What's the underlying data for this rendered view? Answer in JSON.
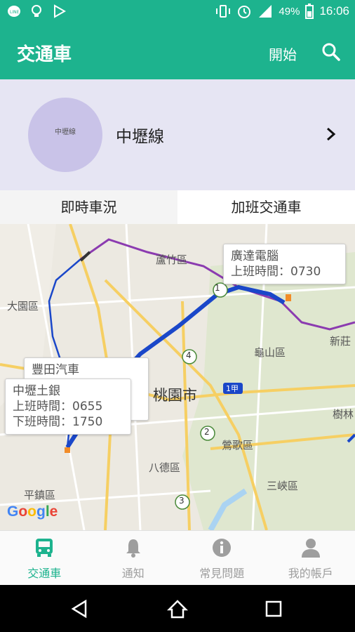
{
  "status": {
    "battery": "49%",
    "time": "16:06"
  },
  "appbar": {
    "title": "交通車",
    "start_label": "開始"
  },
  "route": {
    "avatar_text": "中壢線",
    "name": "中壢線"
  },
  "tabs": [
    {
      "label": "即時車況",
      "active": true
    },
    {
      "label": "加班交通車",
      "active": false
    }
  ],
  "map": {
    "places": {
      "luzhu": "蘆竹區",
      "dayuan": "大園區",
      "guishan": "龜山區",
      "xinzhuang": "新莊",
      "taoyuan": "桃園市",
      "yingge": "鶯歌區",
      "shulin": "樹林",
      "bade": "八德區",
      "sanxia": "三峽區",
      "pingzhen": "平鎮區"
    },
    "road_labels": [
      "1",
      "4",
      "1甲",
      "2",
      "3"
    ],
    "callouts": {
      "guangda": {
        "name": "廣達電腦",
        "line1": "上班時間：0730"
      },
      "toyota": {
        "name": "豐田汽車"
      },
      "zhongli": {
        "name": "中壢土銀",
        "line1": "上班時間：0655",
        "line2": "下班時間：1750"
      }
    },
    "google": [
      "G",
      "o",
      "o",
      "g",
      "l",
      "e"
    ]
  },
  "bottomnav": [
    {
      "label": "交通車",
      "icon": "bus-icon",
      "active": true
    },
    {
      "label": "通知",
      "icon": "bell-icon",
      "active": false
    },
    {
      "label": "常見問題",
      "icon": "info-icon",
      "active": false
    },
    {
      "label": "我的帳戶",
      "icon": "person-icon",
      "active": false
    }
  ],
  "colors": {
    "accent": "#1db38e",
    "route_blue": "#1a47c9",
    "route_purple": "#8b3bb0",
    "header_bg": "#e6e5f3"
  }
}
